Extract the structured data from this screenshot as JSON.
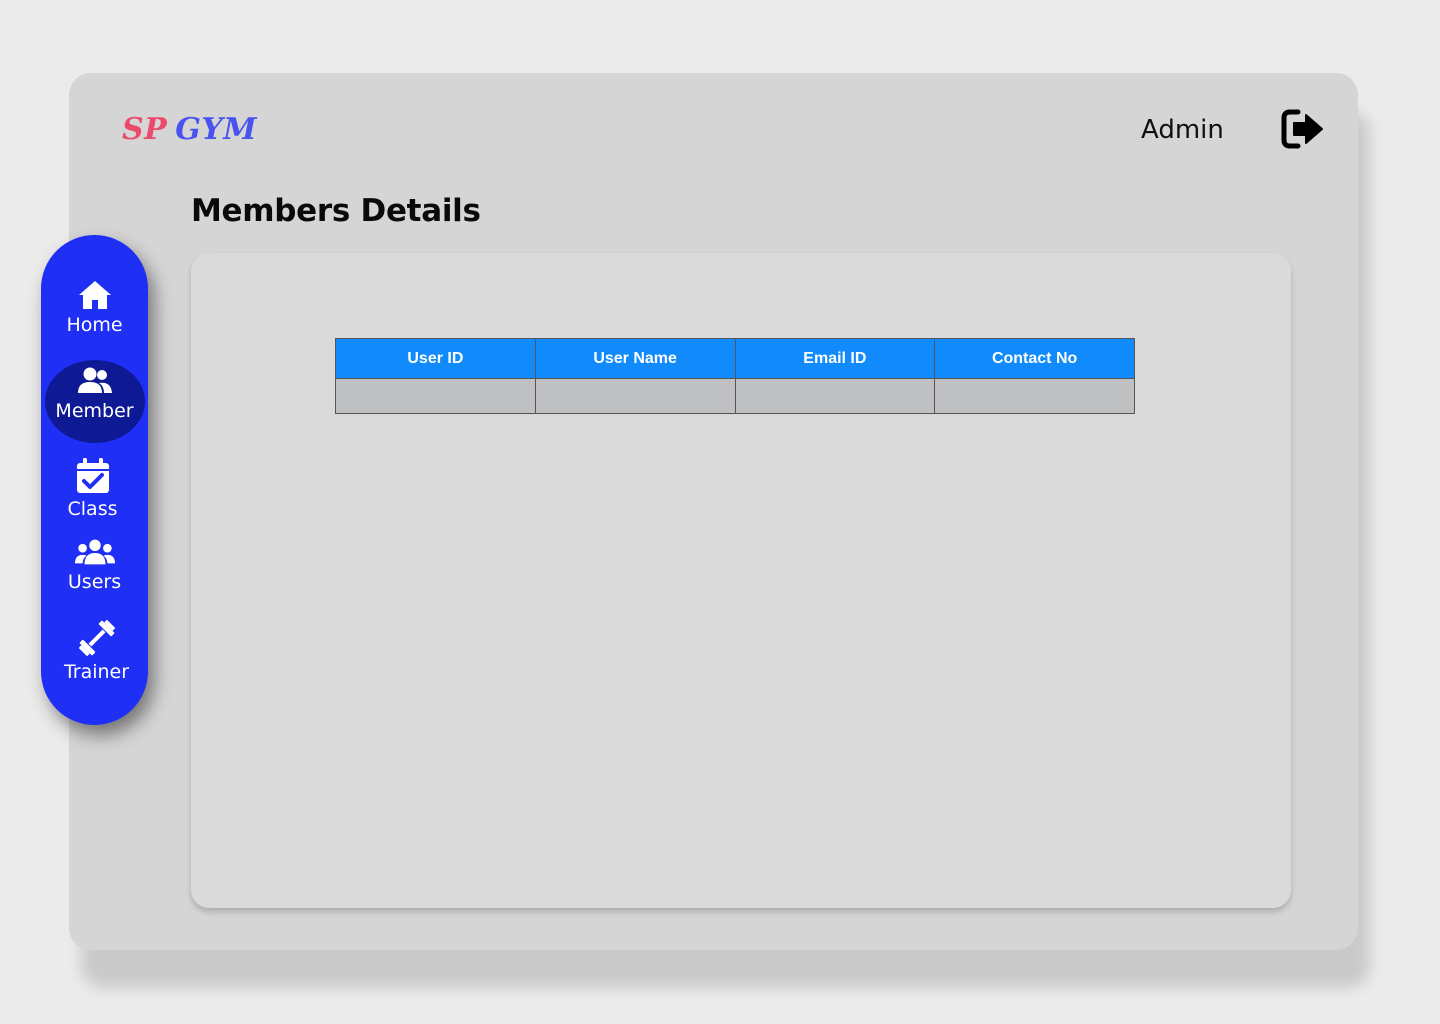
{
  "app": {
    "logo_part1": "SP",
    "logo_part2": "GYM",
    "brand_colors": {
      "sp": "#ec4a6a",
      "gym": "#4a53ef",
      "sidebar": "#1f2ff5",
      "table_header": "#118bfb"
    }
  },
  "header": {
    "user_label": "Admin",
    "logout_icon": "logout-icon"
  },
  "page": {
    "title": "Members Details"
  },
  "sidebar": {
    "items": [
      {
        "label": "Home",
        "icon": "home-icon",
        "active": false
      },
      {
        "label": "Member",
        "icon": "member-icon",
        "active": true
      },
      {
        "label": "Class",
        "icon": "calendar-check-icon",
        "active": false
      },
      {
        "label": "Users",
        "icon": "users-icon",
        "active": false
      },
      {
        "label": "Trainer",
        "icon": "dumbbell-icon",
        "active": false
      }
    ]
  },
  "table": {
    "columns": [
      "User ID",
      "User Name",
      "Email ID",
      "Contact No"
    ],
    "rows": [
      [
        "",
        "",
        "",
        ""
      ]
    ]
  }
}
